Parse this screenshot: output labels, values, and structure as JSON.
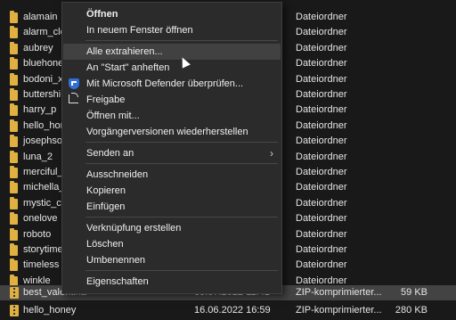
{
  "files": [
    {
      "name": "alamain",
      "date": "",
      "type": "Dateiordner",
      "size": "",
      "kind": "folder"
    },
    {
      "name": "alarm_cloc",
      "date": "",
      "type": "Dateiordner",
      "size": "",
      "kind": "folder"
    },
    {
      "name": "aubrey",
      "date": "",
      "type": "Dateiordner",
      "size": "",
      "kind": "folder"
    },
    {
      "name": "bluehones",
      "date": "",
      "type": "Dateiordner",
      "size": "",
      "kind": "folder"
    },
    {
      "name": "bodoni_xt",
      "date": "",
      "type": "Dateiordner",
      "size": "",
      "kind": "folder"
    },
    {
      "name": "buttershine",
      "date": "",
      "type": "Dateiordner",
      "size": "",
      "kind": "folder"
    },
    {
      "name": "harry_p",
      "date": "",
      "type": "Dateiordner",
      "size": "",
      "kind": "folder"
    },
    {
      "name": "hello_hone",
      "date": "",
      "type": "Dateiordner",
      "size": "",
      "kind": "folder"
    },
    {
      "name": "josephsop",
      "date": "",
      "type": "Dateiordner",
      "size": "",
      "kind": "folder"
    },
    {
      "name": "luna_2",
      "date": "",
      "type": "Dateiordner",
      "size": "",
      "kind": "folder"
    },
    {
      "name": "merciful_h",
      "date": "",
      "type": "Dateiordner",
      "size": "",
      "kind": "folder"
    },
    {
      "name": "michella_g",
      "date": "",
      "type": "Dateiordner",
      "size": "",
      "kind": "folder"
    },
    {
      "name": "mystic_crys",
      "date": "",
      "type": "Dateiordner",
      "size": "",
      "kind": "folder"
    },
    {
      "name": "onelove",
      "date": "",
      "type": "Dateiordner",
      "size": "",
      "kind": "folder"
    },
    {
      "name": "roboto",
      "date": "",
      "type": "Dateiordner",
      "size": "",
      "kind": "folder"
    },
    {
      "name": "storytime_",
      "date": "",
      "type": "Dateiordner",
      "size": "",
      "kind": "folder"
    },
    {
      "name": "timeless",
      "date": "",
      "type": "Dateiordner",
      "size": "",
      "kind": "folder"
    },
    {
      "name": "winkle",
      "date": "",
      "type": "Dateiordner",
      "size": "",
      "kind": "folder"
    },
    {
      "name": "best_valentina",
      "date": "05.07.2022 11:41",
      "type": "ZIP-komprimierter...",
      "size": "59 KB",
      "kind": "zip",
      "selected": true
    },
    {
      "name": "hello_honey",
      "date": "16.06.2022 16:59",
      "type": "ZIP-komprimierter...",
      "size": "280 KB",
      "kind": "zip"
    }
  ],
  "context_menu": {
    "items": [
      {
        "label": "Öffnen",
        "bold": true,
        "icon": ""
      },
      {
        "label": "In neuem Fenster öffnen",
        "icon": ""
      },
      {
        "separator": true
      },
      {
        "label": "Alle extrahieren...",
        "icon": "",
        "hover": true
      },
      {
        "label": "An \"Start\" anheften",
        "icon": ""
      },
      {
        "label": "Mit Microsoft Defender überprüfen...",
        "icon": "defender-shield-icon"
      },
      {
        "label": "Freigabe",
        "icon": "share-icon"
      },
      {
        "label": "Öffnen mit...",
        "icon": ""
      },
      {
        "label": "Vorgängerversionen wiederherstellen",
        "icon": ""
      },
      {
        "separator": true
      },
      {
        "label": "Senden an",
        "icon": "",
        "submenu": true
      },
      {
        "separator": true
      },
      {
        "label": "Ausschneiden",
        "icon": ""
      },
      {
        "label": "Kopieren",
        "icon": ""
      },
      {
        "label": "Einfügen",
        "icon": ""
      },
      {
        "separator": true
      },
      {
        "label": "Verknüpfung erstellen",
        "icon": ""
      },
      {
        "label": "Löschen",
        "icon": ""
      },
      {
        "label": "Umbenennen",
        "icon": ""
      },
      {
        "separator": true
      },
      {
        "label": "Eigenschaften",
        "icon": ""
      }
    ]
  },
  "colors": {
    "background": "#191919",
    "menu_bg": "#2b2b2b",
    "hover": "#414141",
    "selected_row": "#434343",
    "folder": "#e0b040",
    "defender": "#2f6fd8"
  }
}
